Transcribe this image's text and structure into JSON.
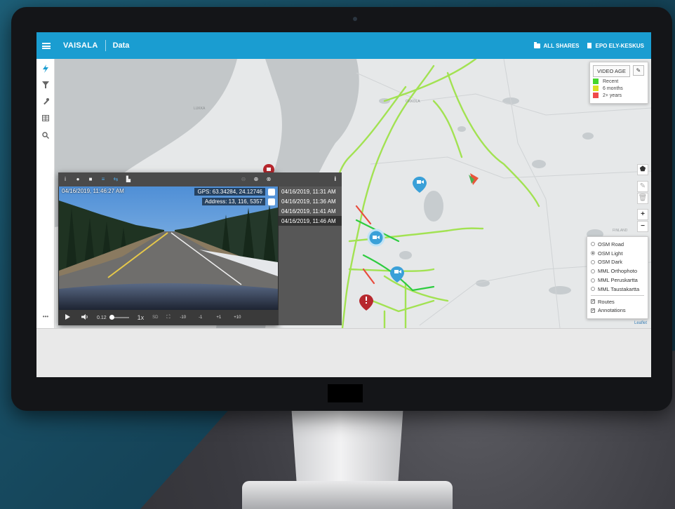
{
  "topbar": {
    "brand": "VAISALA",
    "app_title": "Data",
    "links": [
      {
        "label": "ALL SHARES",
        "icon": "folder-icon"
      },
      {
        "label": "EPO ELY-KESKUS",
        "icon": "document-icon"
      }
    ]
  },
  "map": {
    "place_labels": [
      "LUKKA",
      "OKKOLA",
      "FINLAND"
    ],
    "legend": {
      "video_age_label": "VIDEO AGE",
      "entries": [
        {
          "label": "Recent",
          "color": "#44d62c"
        },
        {
          "label": "6 months",
          "color": "#d9e021"
        },
        {
          "label": "2+ years",
          "color": "#ef4a4a"
        }
      ]
    },
    "zoom": {
      "in": "+",
      "out": "−"
    },
    "base_layers": [
      {
        "label": "OSM Road",
        "selected": false
      },
      {
        "label": "OSM Light",
        "selected": true
      },
      {
        "label": "OSM Dark",
        "selected": false
      },
      {
        "label": "MML Orthophoto",
        "selected": false
      },
      {
        "label": "MML Peruskartta",
        "selected": false
      },
      {
        "label": "MML Taustakartta",
        "selected": false
      }
    ],
    "overlays": [
      {
        "label": "Routes",
        "checked": true
      },
      {
        "label": "Annotations",
        "checked": true
      }
    ],
    "attribution": "Leaflet"
  },
  "video": {
    "timestamp": "04/16/2019, 11:46:27 AM",
    "gps": "GPS: 63.34284, 24.12746",
    "address": "Address: 13, 116, 5357",
    "time_display": "0.12",
    "speed": "1x",
    "quality": "SD",
    "skip_buttons": [
      "-10",
      "-1",
      "+1",
      "+10"
    ]
  },
  "timestamps": {
    "info_icon": "i",
    "items": [
      {
        "label": "04/16/2019, 11:31 AM",
        "selected": false
      },
      {
        "label": "04/16/2019, 11:36 AM",
        "selected": false
      },
      {
        "label": "04/16/2019, 11:41 AM",
        "selected": false
      },
      {
        "label": "04/16/2019, 11:46 AM",
        "selected": true
      }
    ]
  },
  "sidebar": {
    "more_label": "•••"
  }
}
